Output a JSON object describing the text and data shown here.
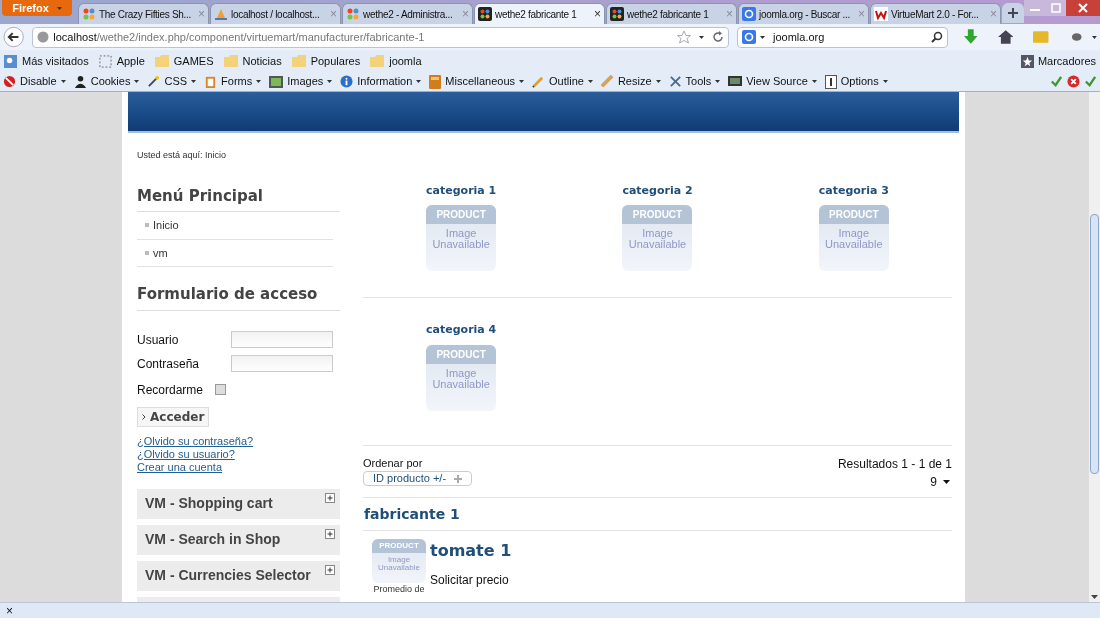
{
  "browser": {
    "menu_button": "Firefox",
    "tabs": [
      {
        "title": "The Crazy Fifties Sh...",
        "selected": false,
        "close": "×"
      },
      {
        "title": "localhost / localhost...",
        "selected": false,
        "close": "×"
      },
      {
        "title": "wethe2 - Administra...",
        "selected": false,
        "close": "×"
      },
      {
        "title": "wethe2 fabricante 1",
        "selected": true,
        "close": "×"
      },
      {
        "title": "wethe2 fabricante 1",
        "selected": false,
        "close": "×"
      },
      {
        "title": "joomla.org - Buscar ...",
        "selected": false,
        "close": "×"
      },
      {
        "title": "VirtueMart 2.0 - For...",
        "selected": false,
        "close": "×"
      }
    ],
    "url_host": "localhost",
    "url_path": "/wethe2/index.php/component/virtuemart/manufacturer/fabricante-1",
    "search_value": "joomla.org",
    "bookmarks": [
      "Más visitados",
      "Apple",
      "GAMES",
      "Noticias",
      "Populares",
      "joomla"
    ],
    "bookmarks_menu": "Marcadores",
    "devtools": [
      "Disable",
      "Cookies",
      "CSS",
      "Forms",
      "Images",
      "Information",
      "Miscellaneous",
      "Outline",
      "Resize",
      "Tools",
      "View Source",
      "Options"
    ],
    "status_close": "×"
  },
  "page": {
    "breadcrumb": "Usted está aquí: Inicio",
    "main_menu": {
      "title": "Menú Principal",
      "items": [
        "Inicio",
        "vm"
      ]
    },
    "login": {
      "title": "Formulario de acceso",
      "fields": [
        {
          "label": "Usuario"
        },
        {
          "label": "Contraseña"
        }
      ],
      "remember": {
        "label": "Recordarme",
        "checked": false
      },
      "submit": "Acceder",
      "links": [
        "¿Olvido su contraseña?",
        "¿Olvido su usuario?",
        "Crear una cuenta"
      ]
    },
    "modules": [
      {
        "kind": "module",
        "title": "VM - Shopping cart",
        "expanded": false
      },
      {
        "kind": "module",
        "title": "VM - Search in Shop",
        "expanded": false
      },
      {
        "kind": "module",
        "title": "VM - Currencies Selector",
        "expanded": false
      },
      {
        "kind": "cut"
      }
    ],
    "categories": [
      {
        "name": "categoria 1",
        "image_top": "PRODUCT",
        "image_text": "Image Unavailable"
      },
      {
        "name": "categoria 2",
        "image_top": "PRODUCT",
        "image_text": "Image Unavailable"
      },
      {
        "name": "categoria 3",
        "image_top": "PRODUCT",
        "image_text": "Image Unavailable"
      },
      {
        "name": "categoria 4",
        "image_top": "PRODUCT",
        "image_text": "Image Unavailable"
      }
    ],
    "order_label": "Ordenar por",
    "order_value": "ID producto +/-",
    "results": "Resultados 1 - 1 de 1",
    "per_page": "9",
    "manufacturer": "fabricante 1",
    "product": {
      "name": "tomate 1",
      "price": "Solicitar precio",
      "image_top": "PRODUCT",
      "image_text": "Image Unavailable",
      "rating_label": "Promedio de"
    }
  }
}
